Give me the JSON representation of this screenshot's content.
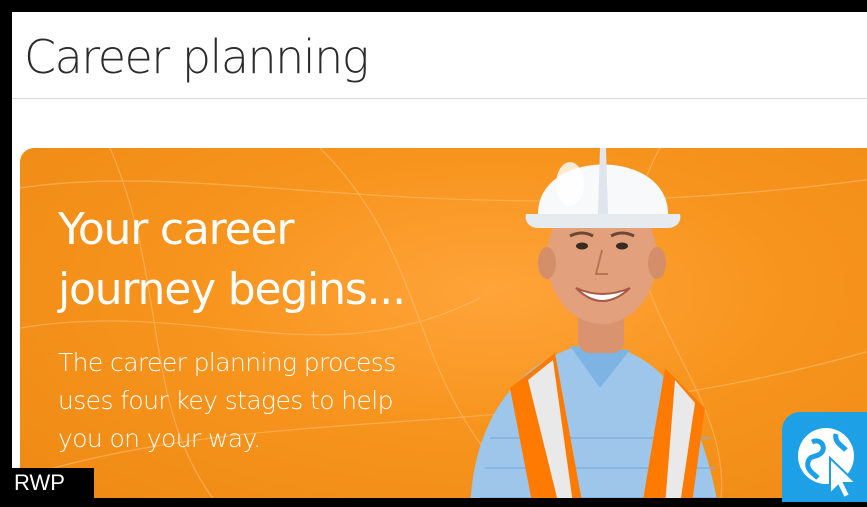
{
  "header": {
    "title": "Career planning"
  },
  "banner": {
    "headline": "Your career journey begins...",
    "body": "The career planning process uses four key stages to help you on your way.",
    "accent_color": "#f7941d"
  },
  "watermark": {
    "label": "RWP"
  },
  "corner_icon": {
    "name": "globe-cursor-icon",
    "color": "#1ea0e6"
  }
}
